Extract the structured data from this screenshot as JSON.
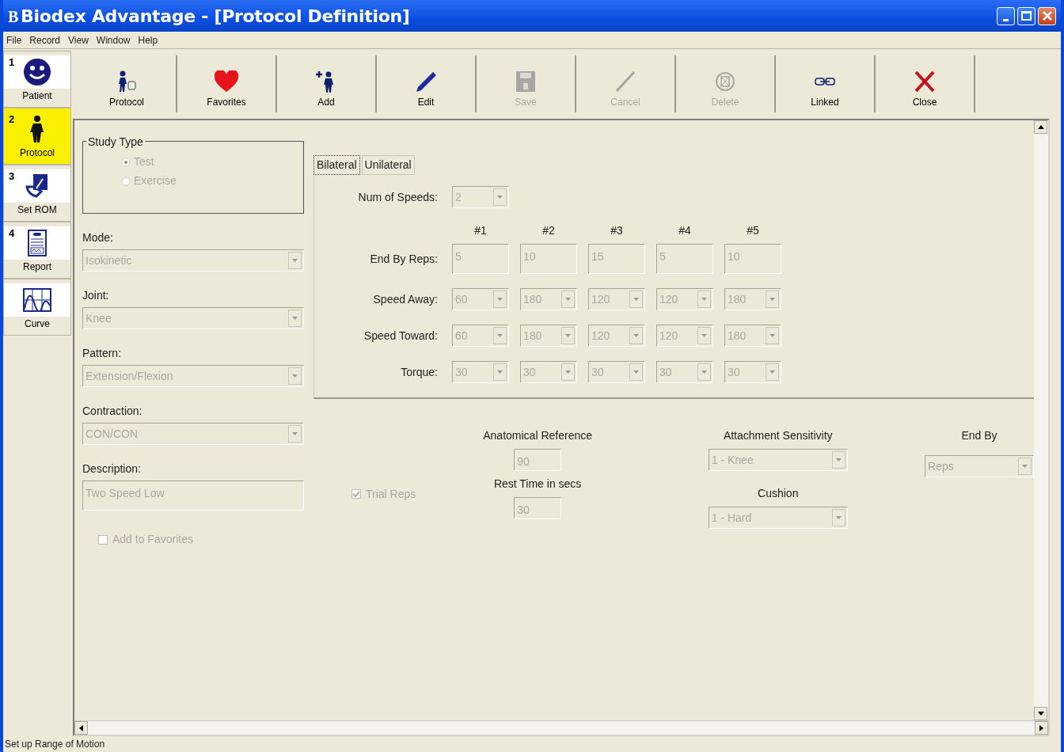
{
  "window": {
    "title": "Biodex Advantage - [Protocol Definition]",
    "logo": "B"
  },
  "menu": [
    "File",
    "Record",
    "View",
    "Window",
    "Help"
  ],
  "toolbar": [
    {
      "label": "Protocol",
      "kind": "protocol",
      "disabled": false
    },
    {
      "label": "Favorites",
      "kind": "heart",
      "disabled": false
    },
    {
      "label": "Add",
      "kind": "add",
      "disabled": false
    },
    {
      "label": "Edit",
      "kind": "pencil",
      "disabled": false
    },
    {
      "label": "Save",
      "kind": "floppy",
      "disabled": true
    },
    {
      "label": "Cancel",
      "kind": "slash",
      "disabled": true
    },
    {
      "label": "Delete",
      "kind": "delete",
      "disabled": true
    },
    {
      "label": "Linked",
      "kind": "link",
      "disabled": false
    },
    {
      "label": "Close",
      "kind": "close",
      "disabled": false
    }
  ],
  "steps": [
    {
      "number": "1",
      "label": "Patient",
      "kind": "smiley",
      "selected": false
    },
    {
      "number": "2",
      "label": "Protocol",
      "kind": "person",
      "selected": true
    },
    {
      "number": "3",
      "label": "Set ROM",
      "kind": "rom",
      "selected": false
    },
    {
      "number": "4",
      "label": "Report",
      "kind": "report",
      "selected": false
    },
    {
      "label": "Curve",
      "kind": "curve",
      "selected": false
    }
  ],
  "form": {
    "disabled": true,
    "study_type": {
      "label": "Study Type",
      "options": [
        {
          "label": "Test",
          "selected": true
        },
        {
          "label": "Exercise",
          "selected": false
        }
      ]
    },
    "fields": [
      {
        "label": "Mode:",
        "value": "Isokinetic",
        "kind": "select"
      },
      {
        "label": "Joint:",
        "value": "Knee",
        "kind": "select"
      },
      {
        "label": "Pattern:",
        "value": "Extension/Flexion",
        "kind": "select"
      },
      {
        "label": "Contraction:",
        "value": "CON/CON",
        "kind": "select"
      },
      {
        "label": "Description:",
        "value": "Two Speed Low",
        "kind": "text"
      }
    ],
    "add_to_favorites": {
      "label": "Add to Favorites",
      "checked": false
    },
    "tabs": [
      {
        "label": "Bilateral",
        "selected": true
      },
      {
        "label": "Unilateral",
        "selected": false
      }
    ],
    "num_of_speeds": {
      "label": "Num of Speeds:",
      "value": "2"
    },
    "speed_columns": [
      "#1",
      "#2",
      "#3",
      "#4",
      "#5"
    ],
    "speed_rows": [
      {
        "label": "End By Reps:",
        "kind": "text",
        "values": [
          "5",
          "10",
          "15",
          "5",
          "10"
        ]
      },
      {
        "label": "Speed Away:",
        "kind": "select",
        "values": [
          "60",
          "180",
          "120",
          "120",
          "180"
        ]
      },
      {
        "label": "Speed Toward:",
        "kind": "select",
        "values": [
          "60",
          "180",
          "120",
          "120",
          "180"
        ]
      },
      {
        "label": "Torque:",
        "kind": "select",
        "values": [
          "30",
          "30",
          "30",
          "30",
          "30"
        ]
      }
    ],
    "trial_reps": {
      "label": "Trial Reps",
      "checked": true
    },
    "anatomical_reference": {
      "label": "Anatomical Reference",
      "value": "90"
    },
    "rest_time": {
      "label": "Rest Time in secs",
      "value": "30"
    },
    "attachment_sensitivity": {
      "label": "Attachment Sensitivity",
      "value": "1 - Knee"
    },
    "cushion": {
      "label": "Cushion",
      "value": "1 - Hard"
    },
    "end_by": {
      "label": "End By",
      "value": "Reps"
    }
  },
  "status_bar": "Set up Range of Motion"
}
